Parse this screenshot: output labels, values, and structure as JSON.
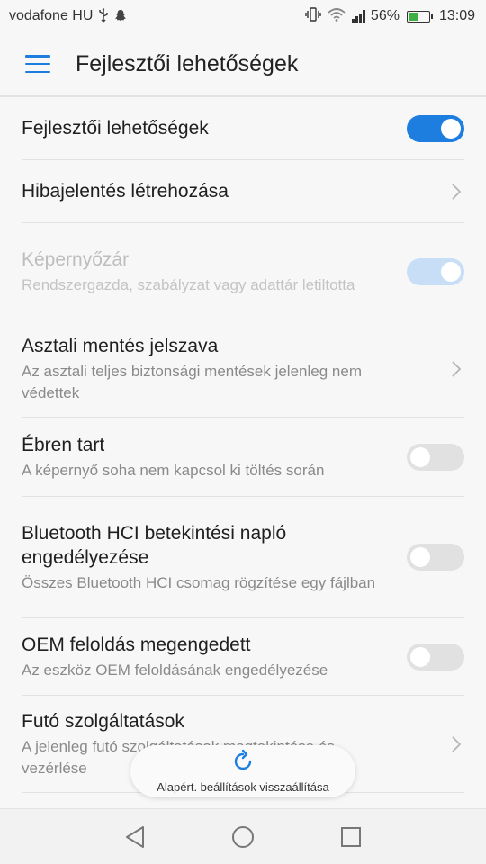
{
  "status_bar": {
    "carrier": "vodafone HU",
    "battery_percent": "56%",
    "battery_level": 0.56,
    "time": "13:09",
    "icons": [
      "usb-icon",
      "snapchat-icon",
      "vibrate-icon",
      "wifi-icon",
      "signal-icon",
      "battery-icon"
    ]
  },
  "app_bar": {
    "title": "Fejlesztői lehetőségek",
    "menu_icon": "hamburger-menu-icon"
  },
  "settings": [
    {
      "title": "Fejlesztői lehetőségek",
      "subtitle": "",
      "control": "switch",
      "state": "on",
      "enabled": true
    },
    {
      "title": "Hibajelentés létrehozása",
      "subtitle": "",
      "control": "chevron",
      "enabled": true
    },
    {
      "title": "Képernyőzár",
      "subtitle": "Rendszergazda, szabályzat vagy adattár letiltotta",
      "control": "switch",
      "state": "on",
      "enabled": false
    },
    {
      "title": "Asztali mentés jelszava",
      "subtitle": "Az asztali teljes biztonsági mentések jelenleg nem védettek",
      "control": "chevron",
      "enabled": true
    },
    {
      "title": "Ébren tart",
      "subtitle": "A képernyő soha nem kapcsol ki töltés során",
      "control": "switch",
      "state": "off",
      "enabled": true
    },
    {
      "title": "Bluetooth HCI betekintési napló engedélyezése",
      "subtitle": "Összes Bluetooth HCI csomag rögzítése egy fájlban",
      "control": "switch",
      "state": "off",
      "enabled": true
    },
    {
      "title": "OEM feloldás megengedett",
      "subtitle": "Az eszköz OEM feloldásának engedélyezése",
      "control": "switch",
      "state": "off",
      "enabled": true
    },
    {
      "title": "Futó szolgáltatások",
      "subtitle": "A jelenleg futó szolgáltatások megtekintése és vezérlése",
      "control": "chevron",
      "enabled": true
    }
  ],
  "toast": {
    "text": "Alapért. beállítások visszaállítása",
    "icon": "refresh-icon"
  },
  "nav_bar": {
    "icons": [
      "back-icon",
      "home-icon",
      "recents-icon"
    ]
  },
  "colors": {
    "accent": "#1d7ee0",
    "switch_off": "#e1e1e1",
    "switch_disabled_on": "#c8def6",
    "battery_fill": "#3cb043",
    "background": "#f7f7f7"
  }
}
